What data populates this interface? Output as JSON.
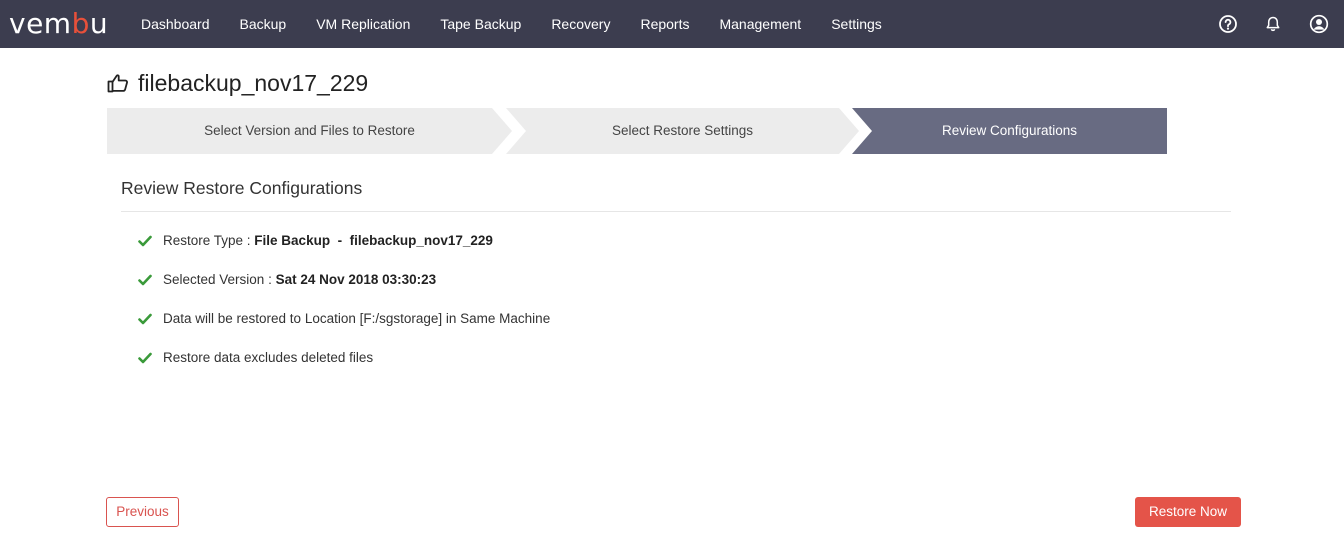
{
  "app": {
    "logo_text_a": "vem",
    "logo_text_b": "b",
    "logo_text_c": "u",
    "brand_accent": "#e8503a",
    "topbar_color": "#3c3d4f"
  },
  "nav": {
    "items": [
      {
        "label": "Dashboard"
      },
      {
        "label": "Backup"
      },
      {
        "label": "VM Replication"
      },
      {
        "label": "Tape Backup"
      },
      {
        "label": "Recovery"
      },
      {
        "label": "Reports"
      },
      {
        "label": "Management"
      },
      {
        "label": "Settings"
      }
    ],
    "icons": [
      "help-icon",
      "bell-icon",
      "user-icon"
    ]
  },
  "page": {
    "title": "filebackup_nov17_229",
    "title_icon": "hand-pointing-icon"
  },
  "wizard": {
    "steps": [
      {
        "label": "Select Version and Files to Restore",
        "active": false
      },
      {
        "label": "Select Restore Settings",
        "active": false
      },
      {
        "label": "Review Configurations",
        "active": true
      }
    ],
    "active_color": "#686b82",
    "inactive_color": "#ececec"
  },
  "review": {
    "heading": "Review Restore Configurations",
    "items": [
      {
        "prefix": "Restore Type : ",
        "bold": "File Backup  -  filebackup_nov17_229",
        "suffix": ""
      },
      {
        "prefix": "Selected Version : ",
        "bold": "Sat 24 Nov 2018 03:30:23",
        "suffix": ""
      },
      {
        "prefix": "Data will be restored to Location [F:/sgstorage] in Same Machine",
        "bold": "",
        "suffix": ""
      },
      {
        "prefix": "Restore data excludes deleted files",
        "bold": "",
        "suffix": ""
      }
    ],
    "check_color": "#3a9a3a"
  },
  "actions": {
    "previous_label": "Previous",
    "restore_label": "Restore Now"
  }
}
